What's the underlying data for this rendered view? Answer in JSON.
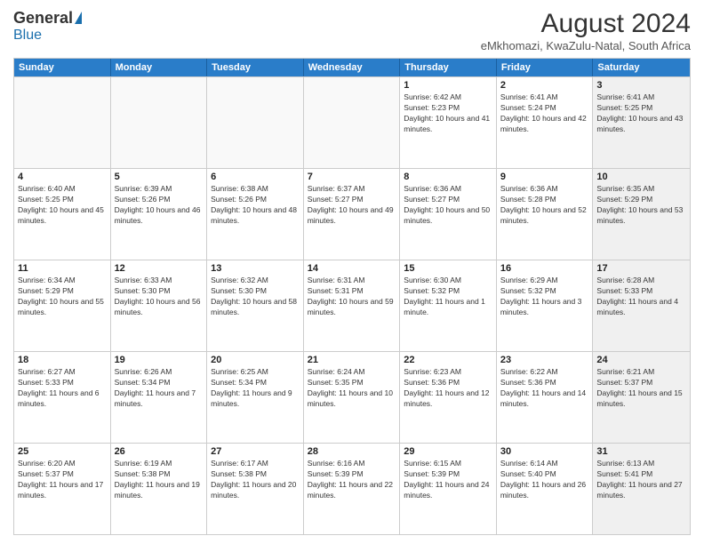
{
  "header": {
    "logo_general": "General",
    "logo_blue": "Blue",
    "main_title": "August 2024",
    "subtitle": "eMkhomazi, KwaZulu-Natal, South Africa"
  },
  "weekdays": [
    "Sunday",
    "Monday",
    "Tuesday",
    "Wednesday",
    "Thursday",
    "Friday",
    "Saturday"
  ],
  "rows": [
    [
      {
        "day": "",
        "empty": true
      },
      {
        "day": "",
        "empty": true
      },
      {
        "day": "",
        "empty": true
      },
      {
        "day": "",
        "empty": true
      },
      {
        "day": "1",
        "sunrise": "6:42 AM",
        "sunset": "5:23 PM",
        "daylight": "10 hours and 41 minutes."
      },
      {
        "day": "2",
        "sunrise": "6:41 AM",
        "sunset": "5:24 PM",
        "daylight": "10 hours and 42 minutes."
      },
      {
        "day": "3",
        "sunrise": "6:41 AM",
        "sunset": "5:25 PM",
        "daylight": "10 hours and 43 minutes.",
        "shaded": true
      }
    ],
    [
      {
        "day": "4",
        "sunrise": "6:40 AM",
        "sunset": "5:25 PM",
        "daylight": "10 hours and 45 minutes."
      },
      {
        "day": "5",
        "sunrise": "6:39 AM",
        "sunset": "5:26 PM",
        "daylight": "10 hours and 46 minutes."
      },
      {
        "day": "6",
        "sunrise": "6:38 AM",
        "sunset": "5:26 PM",
        "daylight": "10 hours and 48 minutes."
      },
      {
        "day": "7",
        "sunrise": "6:37 AM",
        "sunset": "5:27 PM",
        "daylight": "10 hours and 49 minutes."
      },
      {
        "day": "8",
        "sunrise": "6:36 AM",
        "sunset": "5:27 PM",
        "daylight": "10 hours and 50 minutes."
      },
      {
        "day": "9",
        "sunrise": "6:36 AM",
        "sunset": "5:28 PM",
        "daylight": "10 hours and 52 minutes."
      },
      {
        "day": "10",
        "sunrise": "6:35 AM",
        "sunset": "5:29 PM",
        "daylight": "10 hours and 53 minutes.",
        "shaded": true
      }
    ],
    [
      {
        "day": "11",
        "sunrise": "6:34 AM",
        "sunset": "5:29 PM",
        "daylight": "10 hours and 55 minutes."
      },
      {
        "day": "12",
        "sunrise": "6:33 AM",
        "sunset": "5:30 PM",
        "daylight": "10 hours and 56 minutes."
      },
      {
        "day": "13",
        "sunrise": "6:32 AM",
        "sunset": "5:30 PM",
        "daylight": "10 hours and 58 minutes."
      },
      {
        "day": "14",
        "sunrise": "6:31 AM",
        "sunset": "5:31 PM",
        "daylight": "10 hours and 59 minutes."
      },
      {
        "day": "15",
        "sunrise": "6:30 AM",
        "sunset": "5:32 PM",
        "daylight": "11 hours and 1 minute."
      },
      {
        "day": "16",
        "sunrise": "6:29 AM",
        "sunset": "5:32 PM",
        "daylight": "11 hours and 3 minutes."
      },
      {
        "day": "17",
        "sunrise": "6:28 AM",
        "sunset": "5:33 PM",
        "daylight": "11 hours and 4 minutes.",
        "shaded": true
      }
    ],
    [
      {
        "day": "18",
        "sunrise": "6:27 AM",
        "sunset": "5:33 PM",
        "daylight": "11 hours and 6 minutes."
      },
      {
        "day": "19",
        "sunrise": "6:26 AM",
        "sunset": "5:34 PM",
        "daylight": "11 hours and 7 minutes."
      },
      {
        "day": "20",
        "sunrise": "6:25 AM",
        "sunset": "5:34 PM",
        "daylight": "11 hours and 9 minutes."
      },
      {
        "day": "21",
        "sunrise": "6:24 AM",
        "sunset": "5:35 PM",
        "daylight": "11 hours and 10 minutes."
      },
      {
        "day": "22",
        "sunrise": "6:23 AM",
        "sunset": "5:36 PM",
        "daylight": "11 hours and 12 minutes."
      },
      {
        "day": "23",
        "sunrise": "6:22 AM",
        "sunset": "5:36 PM",
        "daylight": "11 hours and 14 minutes."
      },
      {
        "day": "24",
        "sunrise": "6:21 AM",
        "sunset": "5:37 PM",
        "daylight": "11 hours and 15 minutes.",
        "shaded": true
      }
    ],
    [
      {
        "day": "25",
        "sunrise": "6:20 AM",
        "sunset": "5:37 PM",
        "daylight": "11 hours and 17 minutes."
      },
      {
        "day": "26",
        "sunrise": "6:19 AM",
        "sunset": "5:38 PM",
        "daylight": "11 hours and 19 minutes."
      },
      {
        "day": "27",
        "sunrise": "6:17 AM",
        "sunset": "5:38 PM",
        "daylight": "11 hours and 20 minutes."
      },
      {
        "day": "28",
        "sunrise": "6:16 AM",
        "sunset": "5:39 PM",
        "daylight": "11 hours and 22 minutes."
      },
      {
        "day": "29",
        "sunrise": "6:15 AM",
        "sunset": "5:39 PM",
        "daylight": "11 hours and 24 minutes."
      },
      {
        "day": "30",
        "sunrise": "6:14 AM",
        "sunset": "5:40 PM",
        "daylight": "11 hours and 26 minutes."
      },
      {
        "day": "31",
        "sunrise": "6:13 AM",
        "sunset": "5:41 PM",
        "daylight": "11 hours and 27 minutes.",
        "shaded": true
      }
    ]
  ]
}
